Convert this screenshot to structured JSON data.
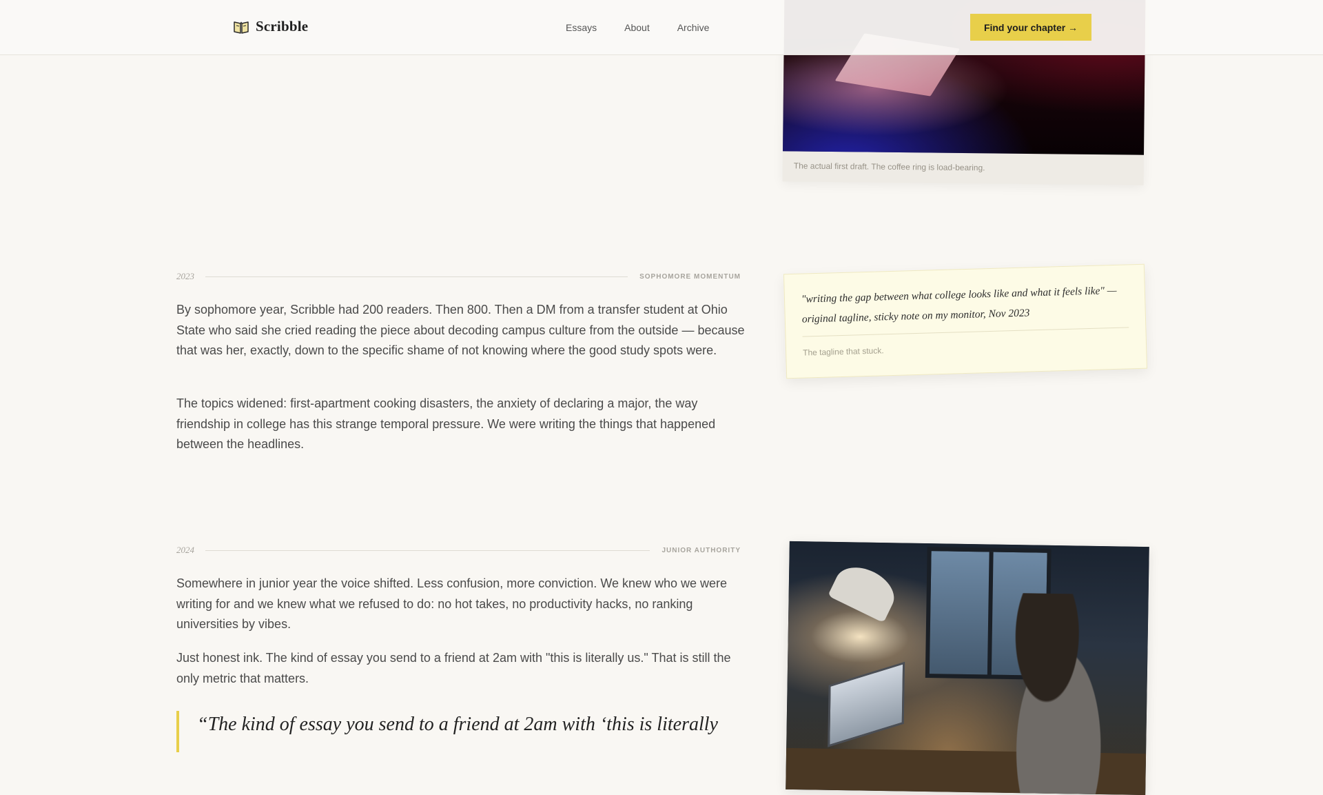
{
  "header": {
    "brand": "Scribble",
    "nav": [
      "Essays",
      "About",
      "Archive"
    ],
    "cta": "Find your chapter →"
  },
  "card_top": {
    "caption": "The actual first draft. The coffee ring is load-bearing."
  },
  "sections": [
    {
      "year": "2023",
      "tag": "SOPHOMORE MOMENTUM",
      "paragraphs": [
        "By sophomore year, Scribble had 200 readers. Then 800. Then a DM from a transfer student at Ohio State who said she cried reading the piece about decoding campus culture from the outside — because that was her, exactly, down to the specific shame of not knowing where the good study spots were.",
        "The topics widened: first-apartment cooking disasters, the anxiety of declaring a major, the way friendship in college has this strange temporal pressure. We were writing the things that happened between the headlines."
      ]
    },
    {
      "year": "2024",
      "tag": "JUNIOR AUTHORITY",
      "paragraphs": [
        "Somewhere in junior year the voice shifted. Less confusion, more conviction. We knew who we were writing for and we knew what we refused to do: no hot takes, no productivity hacks, no ranking universities by vibes.",
        "Just honest ink. The kind of essay you send to a friend at 2am with \"this is literally us.\" That is still the only metric that matters."
      ]
    }
  ],
  "sticky": {
    "quote": "\"writing the gap between what college looks like and what it feels like\" — original tagline, sticky note on my monitor, Nov 2023",
    "caption": "The tagline that stuck."
  },
  "pull_quote": "“The kind of essay you send to a friend at 2am with ‘this is literally",
  "colors": {
    "accent": "#e8cf4a",
    "background": "#f9f7f3",
    "sticky": "#fdfbe6"
  }
}
